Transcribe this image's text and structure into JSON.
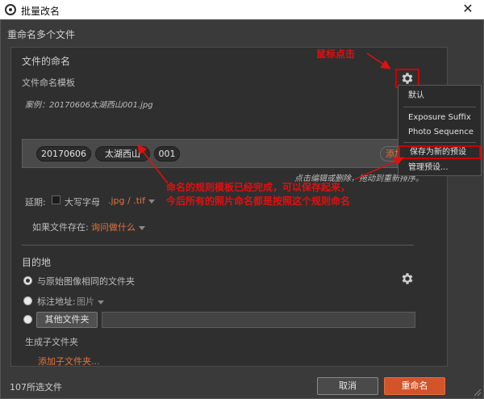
{
  "window": {
    "title": "批量改名",
    "close_glyph": "✕"
  },
  "dialog": {
    "title": "重命名多个文件"
  },
  "file_naming": {
    "section_title": "文件的命名",
    "template_label": "文件命名模板",
    "example": "案例：20170606太湖西山001.jpg",
    "tokens": [
      "20170606",
      "太湖西山",
      "001"
    ],
    "add_label": "添加…",
    "hint": "点击编辑或删除，拖动到重新排序。",
    "extension_label": "延期:",
    "uppercase_label": "大写字母",
    "extension_value": ".jpg / .tif",
    "if_exists_label": "如果文件存在:",
    "if_exists_value": "询问做什么"
  },
  "destination": {
    "section_title": "目的地",
    "same_folder_label": "与原始图像相同的文件夹",
    "path_label": "标注地址:",
    "path_value": "图片",
    "other_folder_button": "其他文件夹",
    "subfolder_label": "生成子文件夹",
    "add_subfolder_link": "添加子文件夹..."
  },
  "footer": {
    "file_count": "107所选文件",
    "cancel_label": "取消",
    "rename_label": "重命名"
  },
  "menu": {
    "items": [
      "默认",
      "Exposure Suffix",
      "Photo Sequence",
      "保存为新的预设",
      "管理预设..."
    ]
  },
  "annotations": {
    "mouse_click": "鼠标点击",
    "note_line1": "命名的规则模板已经完成，可以保存起来，",
    "note_line2": "今后所有的照片命名都是按照这个规则命名"
  },
  "colors": {
    "accent_orange": "#e6743a",
    "primary_button": "#d4542a",
    "annotation_red": "#e01010"
  }
}
